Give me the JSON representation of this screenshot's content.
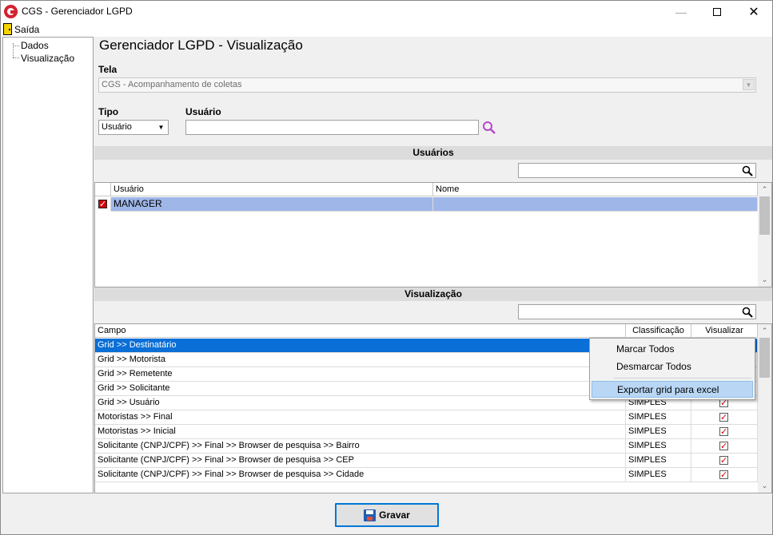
{
  "window": {
    "title": "CGS - Gerenciador LGPD"
  },
  "menu": {
    "saida": "Saída"
  },
  "sidebar": {
    "items": [
      {
        "label": "Dados"
      },
      {
        "label": "Visualização"
      }
    ]
  },
  "page_title": "Gerenciador LGPD - Visualização",
  "tela": {
    "label": "Tela",
    "value": "CGS - Acompanhamento de coletas"
  },
  "tipo": {
    "label": "Tipo",
    "value": "Usuário"
  },
  "usuario": {
    "label": "Usuário",
    "value": ""
  },
  "usuarios_section": {
    "title": "Usuários",
    "search_value": "",
    "columns": [
      "Usuário",
      "Nome"
    ],
    "rows": [
      {
        "usuario": "MANAGER",
        "nome": "",
        "checked": true
      }
    ]
  },
  "visualizacao_section": {
    "title": "Visualização",
    "search_value": "",
    "columns": [
      "Campo",
      "Classificação",
      "Visualizar"
    ],
    "rows": [
      {
        "campo": "Grid >> Destinatário",
        "classificacao": "",
        "visualizar": false,
        "selected": true
      },
      {
        "campo": "Grid >> Motorista",
        "classificacao": "",
        "visualizar": false
      },
      {
        "campo": "Grid >> Remetente",
        "classificacao": "",
        "visualizar": false
      },
      {
        "campo": "Grid >> Solicitante",
        "classificacao": "",
        "visualizar": false
      },
      {
        "campo": "Grid >> Usuário",
        "classificacao": "SIMPLES",
        "visualizar": true
      },
      {
        "campo": "Motoristas >> Final",
        "classificacao": "SIMPLES",
        "visualizar": true
      },
      {
        "campo": "Motoristas >> Inicial",
        "classificacao": "SIMPLES",
        "visualizar": true
      },
      {
        "campo": "Solicitante (CNPJ/CPF) >> Final >> Browser de pesquisa >> Bairro",
        "classificacao": "SIMPLES",
        "visualizar": true
      },
      {
        "campo": "Solicitante (CNPJ/CPF) >> Final >> Browser de pesquisa >> CEP",
        "classificacao": "SIMPLES",
        "visualizar": true
      },
      {
        "campo": "Solicitante (CNPJ/CPF) >> Final >> Browser de pesquisa >> Cidade",
        "classificacao": "SIMPLES",
        "visualizar": true
      }
    ]
  },
  "context_menu": {
    "items": [
      "Marcar Todos",
      "Desmarcar Todos",
      "Exportar grid para excel"
    ],
    "highlighted": "Exportar grid para excel"
  },
  "gravar": {
    "label": "Gravar"
  },
  "colors": {
    "selection": "#0a6fd6",
    "user_selection": "#9fb6e8",
    "check_red": "#d80000"
  }
}
